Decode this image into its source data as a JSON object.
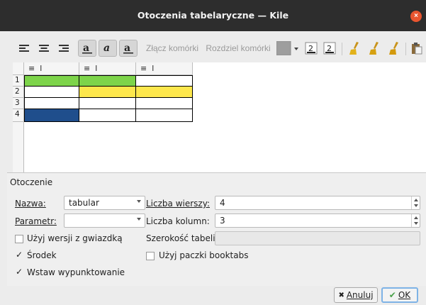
{
  "window": {
    "title": "Otoczenia tabelaryczne — Kile",
    "close_glyph": "×"
  },
  "toolbar": {
    "merge_cells": "Złącz komórki",
    "split_cells": "Rozdziel komórki",
    "color_swatch": "#9e9e9e",
    "brush_colors": [
      "#e2b21a",
      "#d6a111",
      "#d39a0d"
    ]
  },
  "table": {
    "col_headers": [
      "≡  l",
      "≡  l",
      "≡  l"
    ],
    "row_numbers": [
      "1",
      "2",
      "3",
      "4"
    ],
    "cells": [
      [
        "#7dd44a",
        "#7dd44a",
        "#ffffff"
      ],
      [
        "#ffffff",
        "#fde74c",
        "#fde74c"
      ],
      [
        "#ffffff",
        "#ffffff",
        "#ffffff"
      ],
      [
        "#1f4e8c",
        "#ffffff",
        "#ffffff"
      ]
    ]
  },
  "env": {
    "section_title": "Otoczenie",
    "name_label": "Nazwa:",
    "name_value": "tabular",
    "param_label": "Parametr:",
    "param_value": "",
    "rows_label": "Liczba wierszy:",
    "rows_value": "4",
    "cols_label": "Liczba kolumn:",
    "cols_value": "3",
    "star_label": "Użyj wersji z gwiazdką",
    "star_checked": false,
    "width_label": "Szerokość tabeli:",
    "width_value": "",
    "center_label": "Środek",
    "center_checked": true,
    "booktabs_label": "Użyj paczki booktabs",
    "booktabs_checked": false,
    "bullets_label": "Wstaw wypunktowanie",
    "bullets_checked": true,
    "check_glyph": "✓"
  },
  "buttons": {
    "cancel": "Anuluj",
    "ok": "OK",
    "cancel_icon": "✖",
    "ok_icon": "✔"
  }
}
